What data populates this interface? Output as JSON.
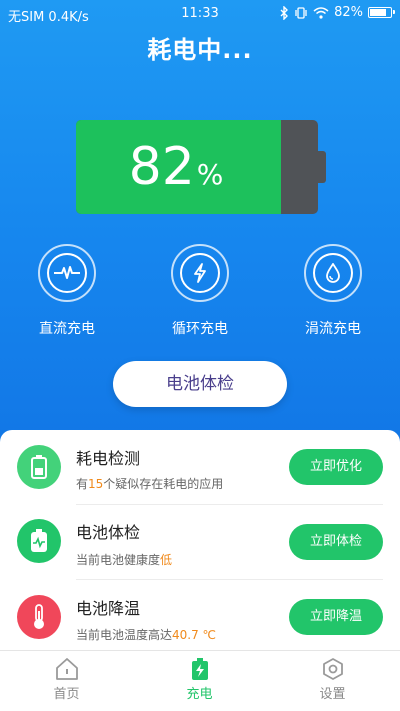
{
  "status_bar": {
    "left": "无SIM 0.4K/s",
    "time": "11:33",
    "battery": "82%"
  },
  "title": "耗电中...",
  "battery": {
    "level": 82,
    "value_text": "82",
    "unit": "%"
  },
  "modes": [
    {
      "label": "直流充电",
      "icon": "pulse-icon"
    },
    {
      "label": "循环充电",
      "icon": "lightning-icon"
    },
    {
      "label": "涓流充电",
      "icon": "droplet-icon"
    }
  ],
  "check_button": "电池体检",
  "list": [
    {
      "title": "耗电检测",
      "sub_prefix": "有",
      "sub_highlight": "15",
      "sub_suffix": "个疑似存在耗电的应用",
      "action": "立即优化",
      "icon": "battery-icon",
      "icon_color": "#43d27a"
    },
    {
      "title": "电池体检",
      "sub_prefix": "当前电池健康度",
      "sub_highlight": "低",
      "sub_suffix": "",
      "action": "立即体检",
      "icon": "battery-health-icon",
      "icon_color": "#22c56a"
    },
    {
      "title": "电池降温",
      "sub_prefix": "当前电池温度高达",
      "sub_highlight": "40.7 ℃",
      "sub_suffix": "",
      "action": "立即降温",
      "icon": "thermometer-icon",
      "icon_color": "#f0475a"
    }
  ],
  "tabs": [
    {
      "label": "首页",
      "icon": "home-icon",
      "active": false
    },
    {
      "label": "充电",
      "icon": "charge-icon",
      "active": true
    },
    {
      "label": "设置",
      "icon": "settings-icon",
      "active": false
    }
  ],
  "colors": {
    "hero_blue": "#1686ee",
    "battery_green": "#1dc15c",
    "action_green": "#22c56a",
    "highlight_orange": "#f08a1c"
  }
}
